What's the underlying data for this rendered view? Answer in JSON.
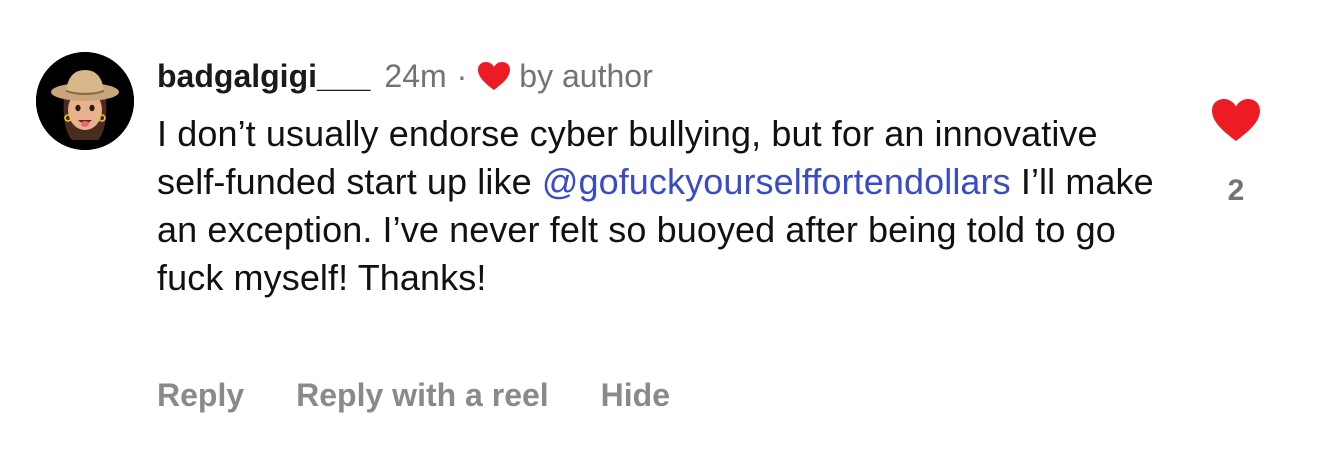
{
  "comment": {
    "username": "badgalgigi___",
    "time": "24m",
    "separator": "·",
    "author_like_label": "by author",
    "text_before": "I don’t usually endorse cyber bullying, but for an innovative self-funded start up like ",
    "mention": "@gofuckyourselffortendollars",
    "text_after": " I’ll make an exception. I’ve never felt so buoyed after being told to go fuck myself! Thanks!",
    "like_count": "2",
    "actions": {
      "reply": "Reply",
      "reply_reel": "Reply with a reel",
      "hide": "Hide"
    }
  },
  "icons": {
    "avatar": "memoji-cowgirl-avatar",
    "author_heart": "heart-icon",
    "like_heart": "heart-icon"
  },
  "colors": {
    "heart": "#ed1c24",
    "mention": "#3a4bc6",
    "muted": "#737373",
    "action": "#8a8a8a"
  }
}
